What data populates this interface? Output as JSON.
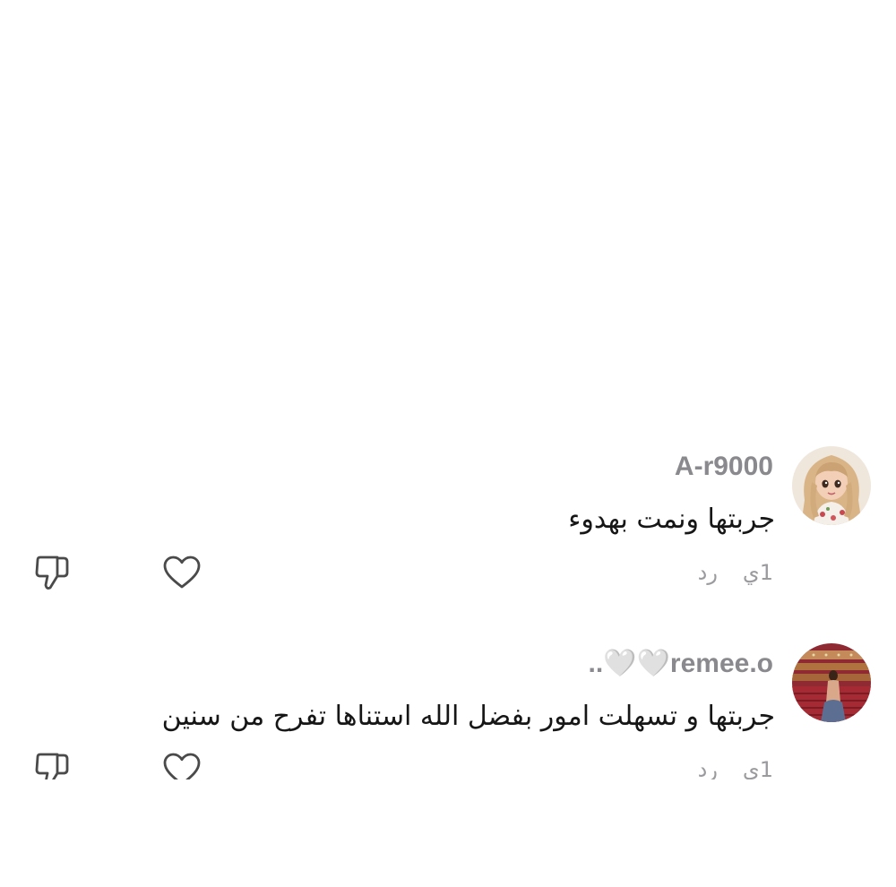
{
  "comments": [
    {
      "username": "A-r9000",
      "text": "جربتها ونمت بهدوء",
      "time": "1ي",
      "reply_label": "رد",
      "avatar_icon": "avatar-cartoon-girl",
      "like_icon": "heart-outline-icon",
      "dislike_icon": "thumbs-down-outline-icon"
    },
    {
      "username": "..🤍🤍remee.o",
      "text": "جربتها و تسهلت امور بفضل الله استناها تفرح من سنين",
      "time": "1ي",
      "reply_label": "رد",
      "avatar_icon": "avatar-theater-stage",
      "like_icon": "heart-outline-icon",
      "dislike_icon": "thumbs-down-outline-icon"
    }
  ],
  "colors": {
    "username": "#8a8a8e",
    "text": "#161616",
    "meta": "#9b9b9f",
    "icon_stroke": "#4a4a4a"
  }
}
